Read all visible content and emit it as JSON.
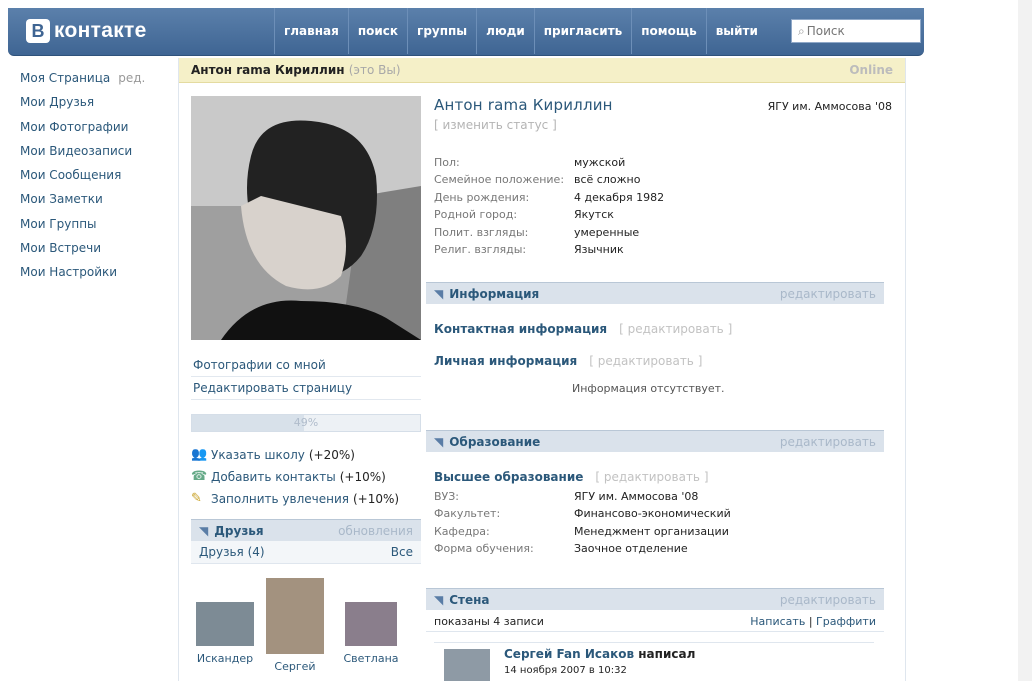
{
  "header": {
    "logo_letter": "B",
    "logo_text": "контакте",
    "nav": [
      "главная",
      "поиск",
      "группы",
      "люди",
      "пригласить",
      "помощь",
      "выйти"
    ],
    "search_placeholder": "Поиск"
  },
  "left_menu": {
    "items": [
      "Моя Страница",
      "Мои Друзья",
      "Мои Фотографии",
      "Мои Видеозаписи",
      "Мои Сообщения",
      "Мои Заметки",
      "Мои Группы",
      "Мои Встречи",
      "Мои Настройки"
    ],
    "edit_label": "ред."
  },
  "namebar": {
    "name": "Антон rama Кириллин",
    "you": "(это Вы)",
    "online": "Online"
  },
  "left_col": {
    "photos_with_me": "Фотографии со мной",
    "edit_page": "Редактировать страницу",
    "progress_label": "49%",
    "progress_value": 49,
    "suggestions": [
      {
        "label": "Указать школу",
        "pct": "(+20%)"
      },
      {
        "label": "Добавить контакты",
        "pct": "(+10%)"
      },
      {
        "label": "Заполнить увлечения",
        "pct": "(+10%)"
      }
    ],
    "friends": {
      "title": "Друзья",
      "updates": "обновления",
      "count_label": "Друзья (4)",
      "all": "Все",
      "names": [
        "Искандер",
        "Сергей",
        "Светлана"
      ]
    }
  },
  "profile": {
    "name": "Антон rama Кириллин",
    "uni": "ЯГУ им. Аммосова '08",
    "change_status": "[ изменить статус ]",
    "fields": [
      {
        "label": "Пол:",
        "value": "мужской"
      },
      {
        "label": "Семейное положение:",
        "value": "всё сложно"
      },
      {
        "label": "День рождения:",
        "value": "4 декабря 1982"
      },
      {
        "label": "Родной город:",
        "value": "Якутск"
      },
      {
        "label": "Полит. взгляды:",
        "value": "умеренные"
      },
      {
        "label": "Религ. взгляды:",
        "value": "Язычник"
      }
    ]
  },
  "info_section": {
    "title": "Информация",
    "edit": "редактировать",
    "contact": "Контактная информация",
    "personal": "Личная информация",
    "edit_bracket": "[ редактировать ]",
    "no_info": "Информация отсутствует."
  },
  "edu_section": {
    "title": "Образование",
    "edit": "редактировать",
    "higher": "Высшее образование",
    "edit_bracket": "[ редактировать ]",
    "fields": [
      {
        "label": "ВУЗ:",
        "value": "ЯГУ им. Аммосова '08"
      },
      {
        "label": "Факультет:",
        "value": "Финансово-экономический"
      },
      {
        "label": "Кафедра:",
        "value": "Менеджмент организации"
      },
      {
        "label": "Форма обучения:",
        "value": "Заочное отделение"
      }
    ]
  },
  "wall_section": {
    "title": "Стена",
    "edit": "редактировать",
    "shown": "показаны 4 записи",
    "write": "Написать",
    "separator": "|",
    "graffiti": "Граффити",
    "post_author": "Сергей Fan Исаков",
    "post_wrote": "написал",
    "post_date": "14 ноября 2007 в 10:32"
  }
}
